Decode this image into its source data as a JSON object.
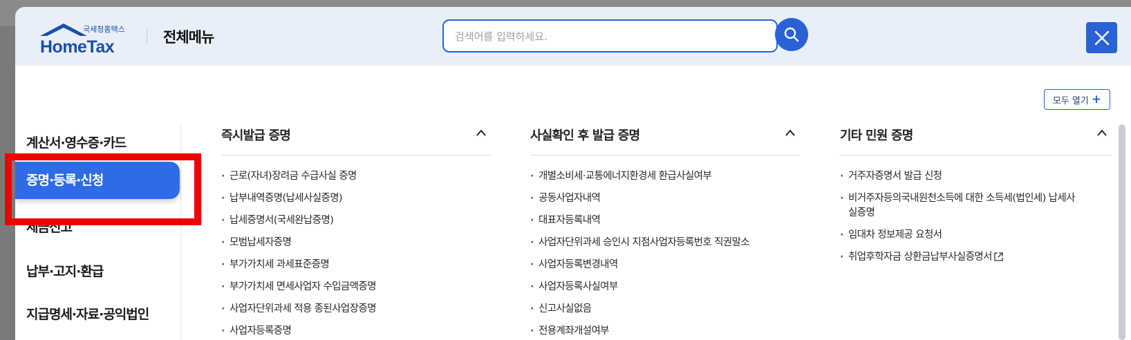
{
  "header": {
    "logo_sub": "국세청홈택스",
    "logo_main": "HomeTax",
    "title": "전체메뉴",
    "search_placeholder": "검색어를 입력하세요."
  },
  "toolbar": {
    "expand_all_label": "모두 열기"
  },
  "left_nav": [
    {
      "label": "계산서·영수증·카드",
      "active": false
    },
    {
      "label": "증명·등록·신청",
      "active": true
    },
    {
      "label": "세금신고",
      "active": false
    },
    {
      "label": "납부·고지·환급",
      "active": false
    },
    {
      "label": "지급명세·자료·공익법인",
      "active": false
    }
  ],
  "columns": [
    {
      "title": "즉시발급 증명",
      "items": [
        "근로(자녀)장려금 수급사실 증명",
        "납부내역증명(납세사실증명)",
        "납세증명서(국세완납증명)",
        "모범납세자증명",
        "부가가치세 과세표준증명",
        "부가가치세 면세사업자 수입금액증명",
        "사업자단위과세 적용 종된사업장증명",
        "사업자등록증명"
      ]
    },
    {
      "title": "사실확인 후 발급 증명",
      "items": [
        "개별소비세·교통에너지환경세 환급사실여부",
        "공동사업자내역",
        "대표자등록내역",
        "사업자단위과세 승인시 지점사업자등록번호 직권말소",
        "사업자등록변경내역",
        "사업자등록사실여부",
        "신고사실없음",
        "전용계좌개설여부"
      ]
    },
    {
      "title": "기타 민원 증명",
      "items": [
        "거주자증명서 발급 신청",
        "비거주자등의국내원천소득에 대한 소득세(법인세) 납세사실증명",
        "임대차 정보제공 요청서",
        "취업후학자금 상환금납부사실증명서"
      ]
    }
  ],
  "colors": {
    "accent": "#2a62d6",
    "active_nav": "#2d6ce6",
    "header_bg": "#e9eff8",
    "highlight": "#f20000"
  }
}
